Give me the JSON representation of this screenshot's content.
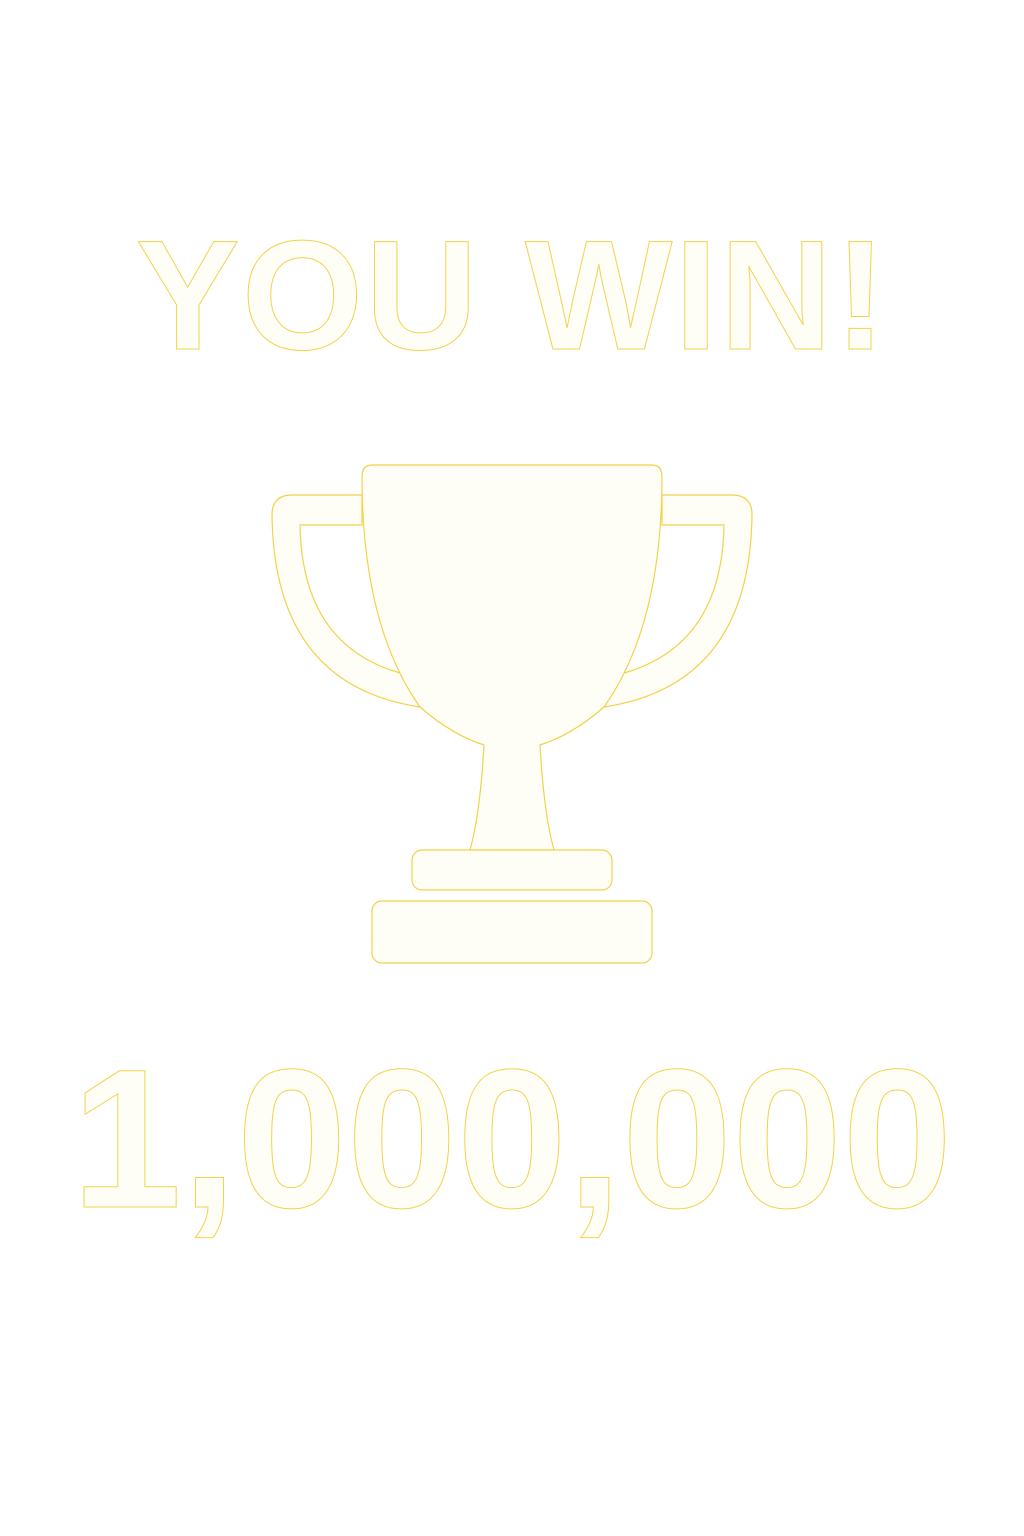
{
  "result": {
    "headline": "YOU WIN!",
    "prize_amount": "1,000,000"
  },
  "icons": {
    "trophy": "trophy-icon"
  },
  "colors": {
    "background": "#ffffff",
    "text_fill": "#fffef6",
    "text_outline": "#f2d24a"
  }
}
